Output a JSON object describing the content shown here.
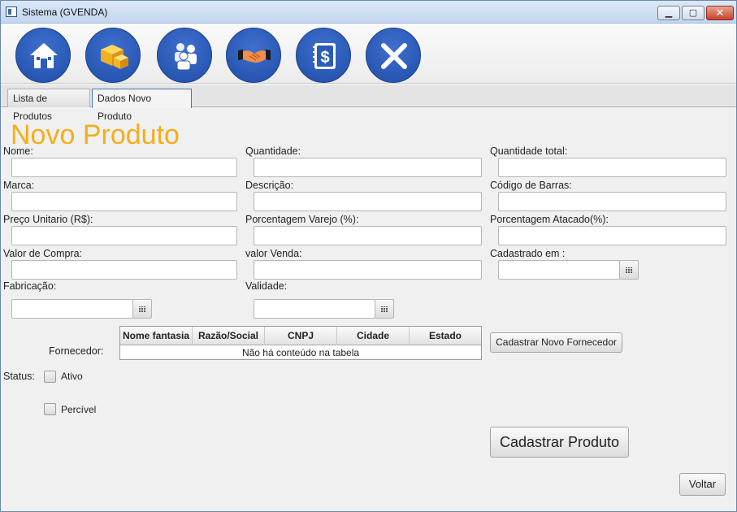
{
  "window": {
    "title": "Sistema (GVENDA)",
    "controls": {
      "minimize": "▁",
      "maximize": "▢",
      "close": "✕"
    }
  },
  "toolbar": {
    "buttons": [
      {
        "name": "home",
        "icon": "house-icon"
      },
      {
        "name": "produtos",
        "icon": "boxes-icon"
      },
      {
        "name": "clientes",
        "icon": "users-icon"
      },
      {
        "name": "fornecedores",
        "icon": "handshake-icon"
      },
      {
        "name": "vendas",
        "icon": "dollar-book-icon"
      },
      {
        "name": "sair",
        "icon": "close-icon"
      }
    ],
    "accent_color": "#2356b3"
  },
  "tabs": [
    {
      "label": "Lista de Produtos",
      "active": false
    },
    {
      "label": "Dados Novo Produto",
      "active": true
    }
  ],
  "form": {
    "heading": "Novo Produto",
    "heading_color": "#f5ad1a",
    "fields": {
      "nome": {
        "label": "Nome:",
        "value": ""
      },
      "quantidade": {
        "label": "Quantidade:",
        "value": ""
      },
      "quantidade_total": {
        "label": "Quantidade total:",
        "value": ""
      },
      "marca": {
        "label": "Marca:",
        "value": ""
      },
      "descricao": {
        "label": "Descrição:",
        "value": ""
      },
      "codigo_barras": {
        "label": "Código de Barras:",
        "value": ""
      },
      "preco_unitario": {
        "label": "Preço Unitario (R$):",
        "value": ""
      },
      "porcentagem_varejo": {
        "label": "Porcentagem Varejo (%):",
        "value": ""
      },
      "porcentagem_atacado": {
        "label": "Porcentagem Atacado(%):",
        "value": ""
      },
      "valor_compra": {
        "label": "Valor de Compra:",
        "value": ""
      },
      "valor_venda": {
        "label": "valor Venda:",
        "value": ""
      },
      "cadastrado_em": {
        "label": "Cadastrado em :",
        "value": ""
      },
      "fabricacao": {
        "label": "Fabricação:",
        "value": ""
      },
      "validade": {
        "label": "Validade:",
        "value": ""
      }
    },
    "fornecedor": {
      "label": "Fornecedor:",
      "columns": [
        "Nome fantasia",
        "Razão/Social",
        "CNPJ",
        "Cidade",
        "Estado"
      ],
      "empty_message": "Não há conteúdo na tabela"
    },
    "cadastrar_fornecedor_label": "Cadastrar Novo Fornecedor",
    "status": {
      "label": "Status:",
      "options": [
        {
          "label": "Ativo",
          "checked": false
        },
        {
          "label": "Percível",
          "checked": false
        }
      ]
    },
    "submit_label": "Cadastrar Produto",
    "back_label": "Voltar"
  }
}
